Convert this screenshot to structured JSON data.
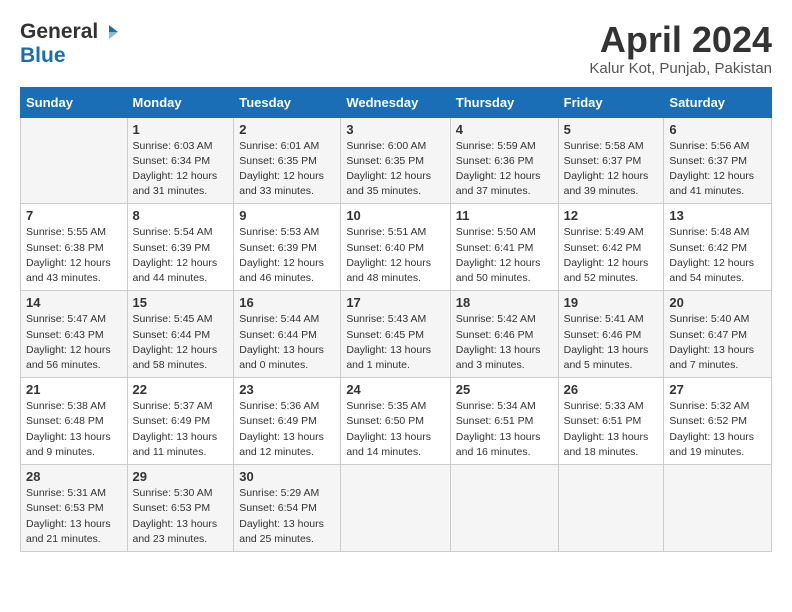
{
  "header": {
    "logo_general": "General",
    "logo_blue": "Blue",
    "title": "April 2024",
    "subtitle": "Kalur Kot, Punjab, Pakistan"
  },
  "days_of_week": [
    "Sunday",
    "Monday",
    "Tuesday",
    "Wednesday",
    "Thursday",
    "Friday",
    "Saturday"
  ],
  "weeks": [
    [
      {
        "day": "",
        "info": ""
      },
      {
        "day": "1",
        "info": "Sunrise: 6:03 AM\nSunset: 6:34 PM\nDaylight: 12 hours\nand 31 minutes."
      },
      {
        "day": "2",
        "info": "Sunrise: 6:01 AM\nSunset: 6:35 PM\nDaylight: 12 hours\nand 33 minutes."
      },
      {
        "day": "3",
        "info": "Sunrise: 6:00 AM\nSunset: 6:35 PM\nDaylight: 12 hours\nand 35 minutes."
      },
      {
        "day": "4",
        "info": "Sunrise: 5:59 AM\nSunset: 6:36 PM\nDaylight: 12 hours\nand 37 minutes."
      },
      {
        "day": "5",
        "info": "Sunrise: 5:58 AM\nSunset: 6:37 PM\nDaylight: 12 hours\nand 39 minutes."
      },
      {
        "day": "6",
        "info": "Sunrise: 5:56 AM\nSunset: 6:37 PM\nDaylight: 12 hours\nand 41 minutes."
      }
    ],
    [
      {
        "day": "7",
        "info": "Sunrise: 5:55 AM\nSunset: 6:38 PM\nDaylight: 12 hours\nand 43 minutes."
      },
      {
        "day": "8",
        "info": "Sunrise: 5:54 AM\nSunset: 6:39 PM\nDaylight: 12 hours\nand 44 minutes."
      },
      {
        "day": "9",
        "info": "Sunrise: 5:53 AM\nSunset: 6:39 PM\nDaylight: 12 hours\nand 46 minutes."
      },
      {
        "day": "10",
        "info": "Sunrise: 5:51 AM\nSunset: 6:40 PM\nDaylight: 12 hours\nand 48 minutes."
      },
      {
        "day": "11",
        "info": "Sunrise: 5:50 AM\nSunset: 6:41 PM\nDaylight: 12 hours\nand 50 minutes."
      },
      {
        "day": "12",
        "info": "Sunrise: 5:49 AM\nSunset: 6:42 PM\nDaylight: 12 hours\nand 52 minutes."
      },
      {
        "day": "13",
        "info": "Sunrise: 5:48 AM\nSunset: 6:42 PM\nDaylight: 12 hours\nand 54 minutes."
      }
    ],
    [
      {
        "day": "14",
        "info": "Sunrise: 5:47 AM\nSunset: 6:43 PM\nDaylight: 12 hours\nand 56 minutes."
      },
      {
        "day": "15",
        "info": "Sunrise: 5:45 AM\nSunset: 6:44 PM\nDaylight: 12 hours\nand 58 minutes."
      },
      {
        "day": "16",
        "info": "Sunrise: 5:44 AM\nSunset: 6:44 PM\nDaylight: 13 hours\nand 0 minutes."
      },
      {
        "day": "17",
        "info": "Sunrise: 5:43 AM\nSunset: 6:45 PM\nDaylight: 13 hours\nand 1 minute."
      },
      {
        "day": "18",
        "info": "Sunrise: 5:42 AM\nSunset: 6:46 PM\nDaylight: 13 hours\nand 3 minutes."
      },
      {
        "day": "19",
        "info": "Sunrise: 5:41 AM\nSunset: 6:46 PM\nDaylight: 13 hours\nand 5 minutes."
      },
      {
        "day": "20",
        "info": "Sunrise: 5:40 AM\nSunset: 6:47 PM\nDaylight: 13 hours\nand 7 minutes."
      }
    ],
    [
      {
        "day": "21",
        "info": "Sunrise: 5:38 AM\nSunset: 6:48 PM\nDaylight: 13 hours\nand 9 minutes."
      },
      {
        "day": "22",
        "info": "Sunrise: 5:37 AM\nSunset: 6:49 PM\nDaylight: 13 hours\nand 11 minutes."
      },
      {
        "day": "23",
        "info": "Sunrise: 5:36 AM\nSunset: 6:49 PM\nDaylight: 13 hours\nand 12 minutes."
      },
      {
        "day": "24",
        "info": "Sunrise: 5:35 AM\nSunset: 6:50 PM\nDaylight: 13 hours\nand 14 minutes."
      },
      {
        "day": "25",
        "info": "Sunrise: 5:34 AM\nSunset: 6:51 PM\nDaylight: 13 hours\nand 16 minutes."
      },
      {
        "day": "26",
        "info": "Sunrise: 5:33 AM\nSunset: 6:51 PM\nDaylight: 13 hours\nand 18 minutes."
      },
      {
        "day": "27",
        "info": "Sunrise: 5:32 AM\nSunset: 6:52 PM\nDaylight: 13 hours\nand 19 minutes."
      }
    ],
    [
      {
        "day": "28",
        "info": "Sunrise: 5:31 AM\nSunset: 6:53 PM\nDaylight: 13 hours\nand 21 minutes."
      },
      {
        "day": "29",
        "info": "Sunrise: 5:30 AM\nSunset: 6:53 PM\nDaylight: 13 hours\nand 23 minutes."
      },
      {
        "day": "30",
        "info": "Sunrise: 5:29 AM\nSunset: 6:54 PM\nDaylight: 13 hours\nand 25 minutes."
      },
      {
        "day": "",
        "info": ""
      },
      {
        "day": "",
        "info": ""
      },
      {
        "day": "",
        "info": ""
      },
      {
        "day": "",
        "info": ""
      }
    ]
  ]
}
